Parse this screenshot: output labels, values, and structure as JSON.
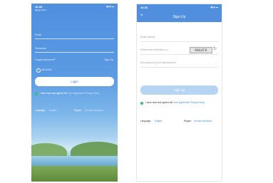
{
  "login": {
    "status_time": "16:28",
    "status_carrier": "◀ App Store",
    "status_icons": "▮▮ ◉ ▬",
    "email_placeholder": "Email",
    "password_placeholder": "Password",
    "forgot_password": "Forgot password?",
    "sign_up": "Sign Up",
    "anti_theft": "Anti-theft",
    "login_button": "Login",
    "agreement_text": "I have read and agreed the",
    "user_agreement": "User Agreement",
    "privacy_policy": "Privacy Policy",
    "language_label": "Language:",
    "language_value": "English",
    "region_label": "Region:",
    "region_value": "Europe and Africa"
  },
  "signup": {
    "status_time": "16:26",
    "status_icons": "▮▮ ◉ ▬",
    "close_icon": "close-icon",
    "title": "Sign Up",
    "email_placeholder": "Email Address",
    "verification_placeholder": "Please enter verification co...",
    "captcha_text": "9064F8",
    "password_placeholder": "New password (6-16 alphanumeric)",
    "sign_up_button": "Sign Up",
    "agreement_text": "I have read and agreed the",
    "user_agreement": "User Agreement",
    "privacy_policy": "Privacy Policy",
    "language_label": "Language:",
    "language_value": "English",
    "region_label": "Region:",
    "region_value": "Europe and Africa"
  },
  "colors": {
    "accent": "#3d8ae6",
    "button_light": "#b6d5f3",
    "check_green": "#2bb673"
  }
}
